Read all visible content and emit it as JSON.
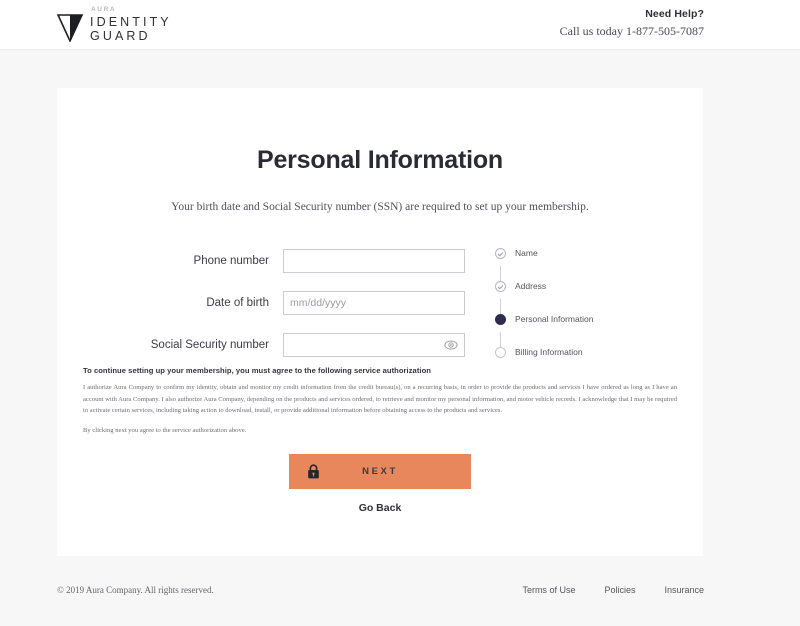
{
  "header": {
    "logo": {
      "brand_small": "AURA",
      "line1": "IDENTITY",
      "line2": "GUARD",
      "mark": "triangle-v-logo"
    },
    "help_title": "Need Help?",
    "help_phone": "Call us today 1-877-505-7087"
  },
  "main": {
    "title": "Personal Information",
    "subtitle": "Your birth date and Social Security number (SSN) are required to set up your membership.",
    "fields": [
      {
        "label": "Phone number",
        "value": "",
        "placeholder": ""
      },
      {
        "label": "Date of birth",
        "value": "",
        "placeholder": "mm/dd/yyyy"
      },
      {
        "label": "Social Security number",
        "value": "",
        "placeholder": ""
      }
    ],
    "ssn_toggle_icon": "eye-icon",
    "steps": [
      {
        "label": "Name",
        "state": "done"
      },
      {
        "label": "Address",
        "state": "done"
      },
      {
        "label": "Personal Information",
        "state": "current"
      },
      {
        "label": "Billing Information",
        "state": "todo"
      }
    ],
    "legal": {
      "heading": "To continue setting up your membership, you must agree to the following service authorization",
      "body": "I authorize Aura Company to confirm my identity, obtain and monitor my credit information from the credit bureau(s), on a recurring basis, in order to provide the products and services I have ordered as long as I have an account with Aura Company. I also authorize Aura Company, depending on the products and services ordered, to retrieve and monitor my personal information, and motor vehicle records. I acknowledge that I may be required to activate certain services, including taking action to download, install, or provide additional information before obtaining access to the products and services.",
      "note": "By clicking next you agree to the service authorization above."
    },
    "next_label": "NEXT",
    "next_icon": "lock-icon",
    "go_back_label": "Go Back"
  },
  "footer": {
    "copyright": "© 2019 Aura Company. All rights reserved.",
    "links": [
      "Terms of Use",
      "Policies",
      "Insurance"
    ]
  },
  "colors": {
    "page_background": "#f7f7f7",
    "card_background": "#ffffff",
    "accent_button": "#e8875b",
    "step_current": "#2d2d4d",
    "text_primary": "#2b2b35"
  }
}
